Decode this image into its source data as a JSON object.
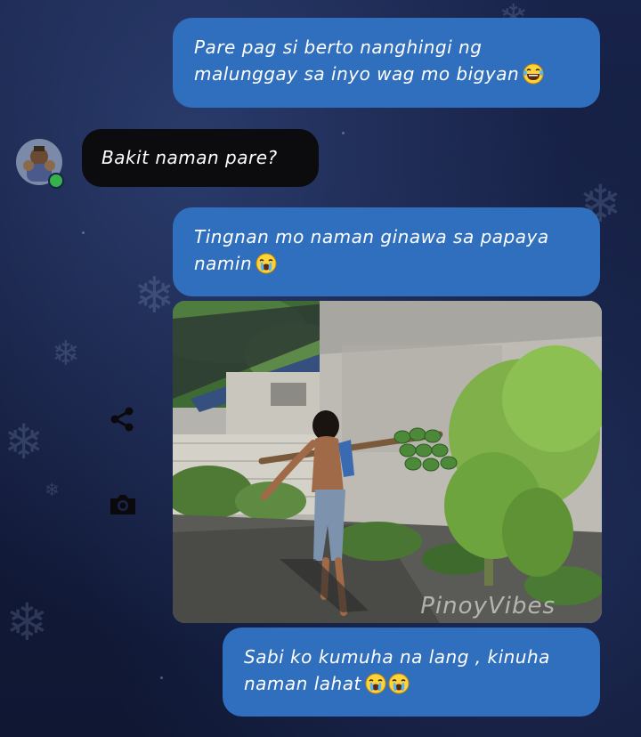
{
  "chat": {
    "messages": [
      {
        "direction": "sent",
        "lines": [
          "Pare pag si berto nanghingi ng",
          "malunggay sa inyo wag mo bigyan"
        ],
        "emoji": [
          "laughing-tears-emoji"
        ]
      },
      {
        "direction": "received",
        "lines": [
          "Bakit naman pare?"
        ],
        "emoji": []
      },
      {
        "direction": "sent",
        "lines": [
          "Tingnan mo naman ginawa sa papaya",
          "namin"
        ],
        "emoji": [
          "crying-emoji"
        ]
      },
      {
        "direction": "sent",
        "type": "photo",
        "watermark": "PinoyVibes"
      },
      {
        "direction": "sent",
        "lines": [
          "Sabi ko kumuha na lang , kinuha",
          "naman lahat"
        ],
        "emoji": [
          "crying-emoji",
          "crying-emoji"
        ]
      }
    ]
  },
  "icons": {
    "share": "share-icon",
    "camera": "camera-icon"
  },
  "colors": {
    "sent_bubble": "#2f6fbd",
    "received_bubble": "#0c0c0e",
    "background": "#18234a",
    "online": "#35b24a"
  }
}
